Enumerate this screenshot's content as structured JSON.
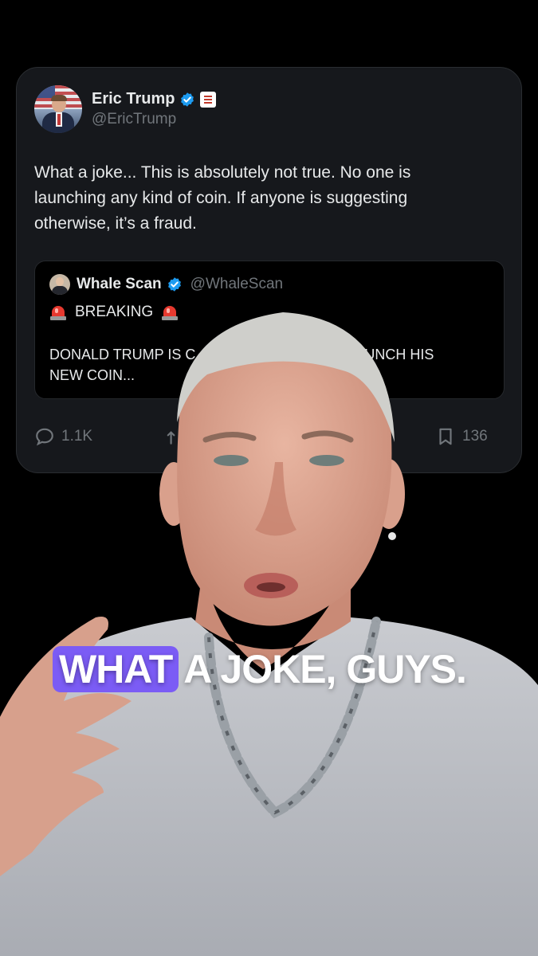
{
  "tweet": {
    "author_name": "Eric Trump",
    "author_handle": "@EricTrump",
    "text": "What a joke... This is absolutely not true. No one is launching any kind of coin. If anyone is suggesting otherwise, it’s a fraud.",
    "quote": {
      "author_name": "Whale Scan",
      "author_handle": "@WhaleScan",
      "breaking_label": "BREAKING",
      "text_visible": "DONALD TRUMP IS C",
      "text_visible_end": "LAUNCH HIS",
      "text_line2": "NEW COIN..."
    },
    "actions": {
      "replies": "1.1K",
      "bookmarks": "136"
    },
    "accent_color": "#1d9bf0"
  },
  "caption": {
    "highlight": "WHAT",
    "rest": "A JOKE, GUYS.",
    "highlight_color": "#7b5cf5"
  },
  "icons": [
    "verified-badge-icon",
    "government-badge-icon",
    "siren-icon",
    "reply-icon",
    "repost-icon",
    "bookmark-icon"
  ]
}
